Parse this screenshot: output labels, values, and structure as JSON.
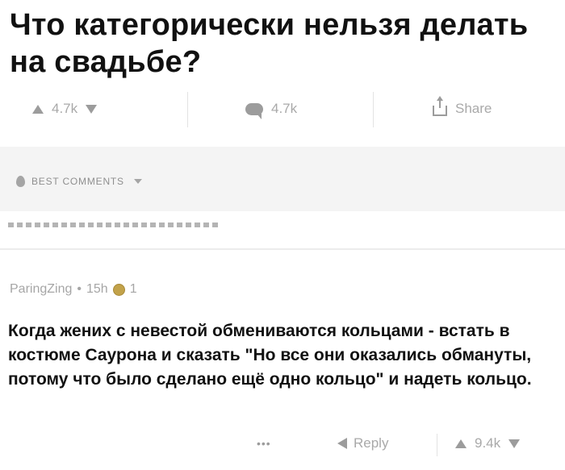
{
  "post": {
    "title": "Что категорически нельзя делать на свадьбе?"
  },
  "actions": {
    "upvotes": "4.7k",
    "comments": "4.7k",
    "share_label": "Share"
  },
  "comments_section": {
    "sort_label": "BEST COMMENTS"
  },
  "comment": {
    "author": "ParingZing",
    "separator": "•",
    "age": "15h",
    "award_count": "1",
    "text": "Когда жених с невестой обмениваются кольцами - встать в костюме Саурона и сказать \"Но все они оказались обмануты, потому что было сделано ещё одно кольцо\" и надеть кольцо.",
    "more_label": "•••",
    "reply_label": "Reply",
    "score": "9.4k"
  },
  "colors": {
    "background": "#ffffff",
    "band": "#f4f4f4",
    "muted_text": "#a9a9a9",
    "icon": "#9c9c9c",
    "award": "#c2a24a"
  }
}
